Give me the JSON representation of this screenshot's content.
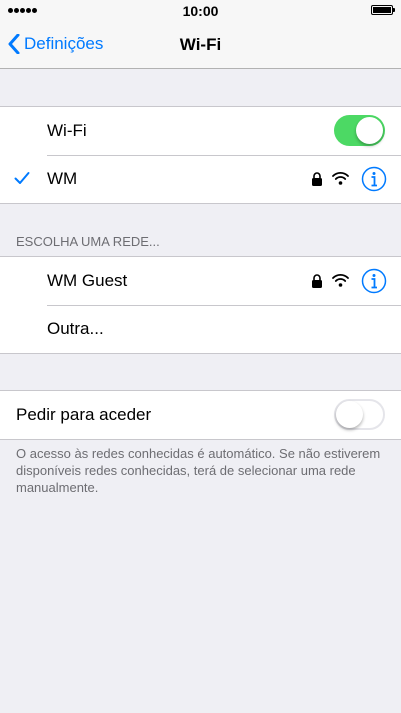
{
  "status_bar": {
    "time": "10:00",
    "signal_icon": "signal-dots-icon",
    "battery_icon": "battery-icon"
  },
  "nav": {
    "back_label": "Definições",
    "title": "Wi-Fi"
  },
  "wifi_section": {
    "wifi_label": "Wi-Fi",
    "wifi_enabled": true,
    "connected_network": "WM",
    "connected_secured": true
  },
  "networks_section": {
    "header": "ESCOLHA UMA REDE...",
    "networks": [
      {
        "name": "WM Guest",
        "secured": true
      }
    ],
    "other_label": "Outra..."
  },
  "ask_section": {
    "label": "Pedir para aceder",
    "enabled": false,
    "footer": "O acesso às redes conhecidas é automático. Se não estiverem disponíveis redes conhecidas, terá de selecionar uma rede manualmente."
  },
  "colors": {
    "accent": "#007aff",
    "toggle_on": "#4cd964",
    "background": "#efeff4"
  }
}
